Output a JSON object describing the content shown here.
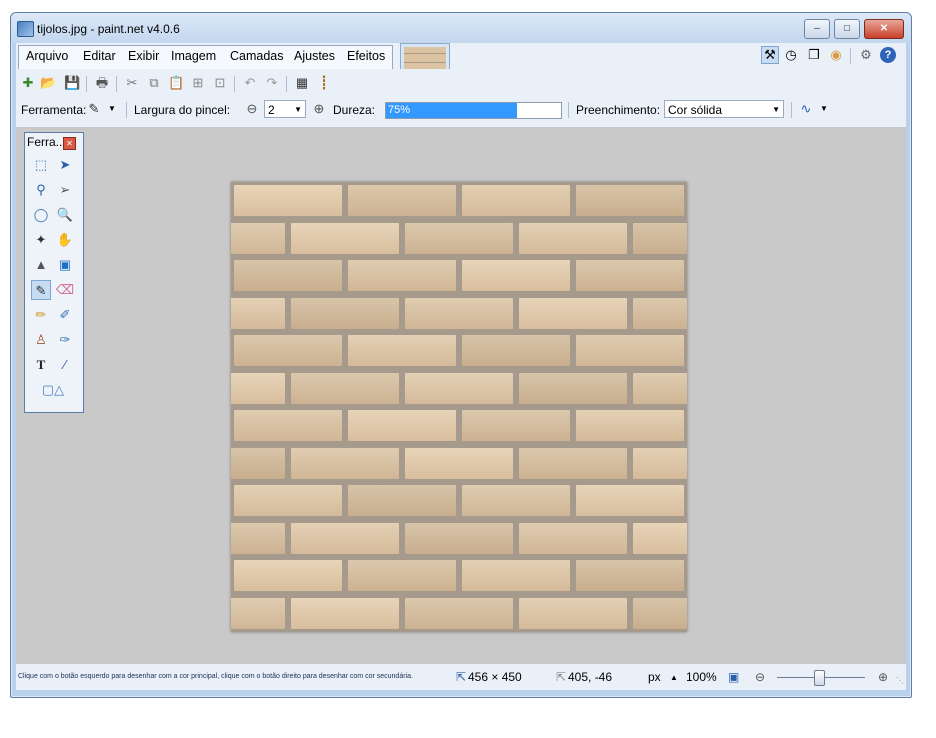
{
  "window": {
    "title": "tijolos.jpg - paint.net v4.0.6"
  },
  "menu": [
    "Arquivo",
    "Editar",
    "Exibir",
    "Imagem",
    "Camadas",
    "Ajustes",
    "Efeitos"
  ],
  "options": {
    "tool_label": "Ferramenta:",
    "brush_width_label": "Largura do pincel:",
    "brush_width_value": "2",
    "hardness_label": "Dureza:",
    "hardness_value": "75%",
    "hardness_fraction": 0.75,
    "fill_label": "Preenchimento:",
    "fill_value": "Cor sólida"
  },
  "tools_panel": {
    "title": "Ferra..."
  },
  "status": {
    "hint": "Clique com o botão esquerdo para desenhar com a cor principal, clique com o botão direito para desenhar com cor secundária.",
    "image_size": "456 × 450",
    "cursor_pos": "405, -46",
    "units": "px",
    "zoom": "100%"
  },
  "colors": {
    "accent": "#3399ff",
    "workspace": "#c9c9c9",
    "brick": "#dcc4a5",
    "mortar": "#a59a8c"
  }
}
